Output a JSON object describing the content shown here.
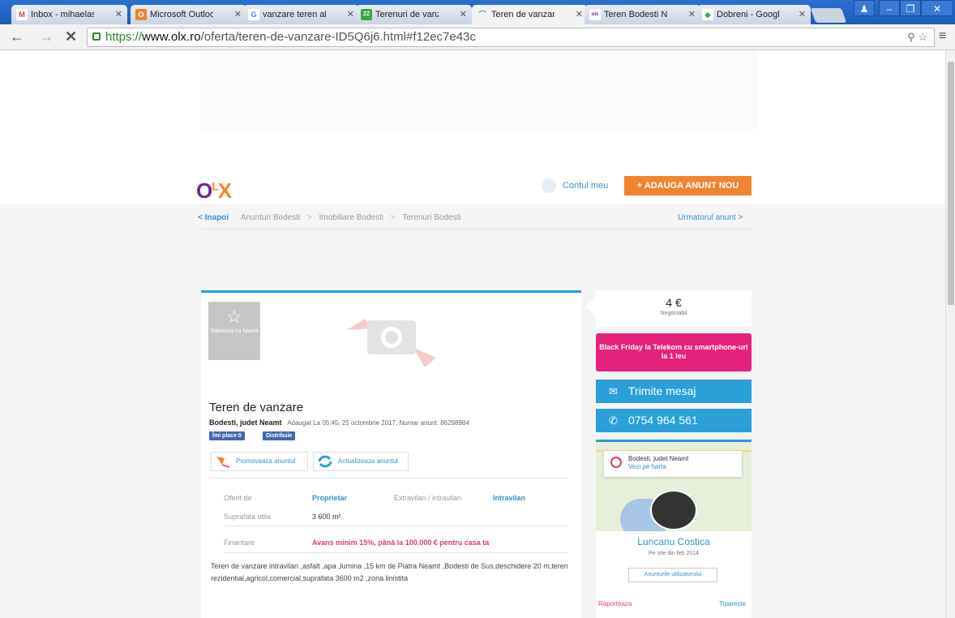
{
  "tabs": [
    {
      "label": "Inbox - mihaelasl",
      "icon": "gmail-icon",
      "color": "#d44638",
      "glyph": "M"
    },
    {
      "label": "Microsoft Outlool",
      "icon": "outlook-icon",
      "color": "#f0852d",
      "glyph": "O"
    },
    {
      "label": "vanzare teren all",
      "icon": "google-icon",
      "color": "#4285f4",
      "glyph": "G"
    },
    {
      "label": "Terenuri de vanz",
      "icon": "zz-icon",
      "color": "#3aa547",
      "glyph": "ZZ"
    },
    {
      "label": "Teren de vanzare",
      "icon": "loading-icon",
      "color": "#2a9fd8",
      "glyph": "⌒"
    },
    {
      "label": "Teren Bodesti NE",
      "icon": "olx-icon",
      "color": "#6a2c91",
      "glyph": "olx"
    },
    {
      "label": "Dobreni - Google",
      "icon": "maps-icon",
      "color": "#34a853",
      "glyph": "◆"
    }
  ],
  "window_controls": {
    "user": "♟",
    "minimize": "–",
    "restore": "❐",
    "close": "✕"
  },
  "nav": {
    "back": "←",
    "forward": "→",
    "stop": "✕"
  },
  "url": {
    "secure": "https://",
    "host": "www.olx.ro",
    "path": "/oferta/teren-de-vanzare-ID5Q6j6.html#f12ec7e43c"
  },
  "omni_icons": "⚲ ☆",
  "menu": "≡",
  "header": {
    "logo_o": "O",
    "logo_l": "L",
    "logo_x": "X",
    "account": "Contul meu",
    "add_ad": "+ ADAUGA ANUNT NOU"
  },
  "breadcrumb": {
    "back": "< Inapoi",
    "items": [
      "Anunturi Bodesti",
      "Imobiliare Bodesti",
      "Terenuri Bodesti"
    ],
    "next": "Urmatorul anunt >"
  },
  "ad": {
    "favorite": "Salveaza ca favorit",
    "title": "Teren de vanzare",
    "location": "Bodesti, judet Neamt",
    "added": "Adaugat La 05:45, 25 octombrie 2017, Numar anunt: 86298984",
    "like": "Îmi place 0",
    "share": "Distribuie",
    "promote": "Promoveaza anuntul",
    "refresh": "Actualizeaza anuntul",
    "details": [
      {
        "label": "Oferit de",
        "value": "Proprietar"
      },
      {
        "label": "Extravilan / intravilan",
        "value": "Intravilan"
      },
      {
        "label": "Suprafata utila",
        "value": "3 600 m²"
      },
      {
        "label": "Finantare",
        "value": "Avans minim 15%, până la 100.000 € pentru casa ta"
      }
    ],
    "description": "Teren de vanzare intravilan ,asfalt ,apa ,lumina ,15 km de Piatra Neamt ,Bodesti de Sus,deschidere 20 m,teren rezidential,agricol,comercial,suprafata 3600 m2 ,zona linistita"
  },
  "sidebar": {
    "price": "4 €",
    "negotiable": "Negociabil",
    "banner": "Black Friday la Telekom cu smartphone-uri la 1 leu",
    "message": "Trimite mesaj",
    "phone": "0754 964 561",
    "map_location": "Bodesti, judet Neamt",
    "map_link": "Vezi pe harta",
    "seller": "Luncanu Costica",
    "since": "Pe site din feb 2014",
    "user_ads": "Anunturile utilizatorului",
    "report": "Raporteaza",
    "print": "Tipareste"
  },
  "colors": {
    "olx_purple": "#6a2c91",
    "olx_orange": "#f0852d",
    "accent_blue": "#2a9fd8",
    "pink": "#e5217b"
  }
}
